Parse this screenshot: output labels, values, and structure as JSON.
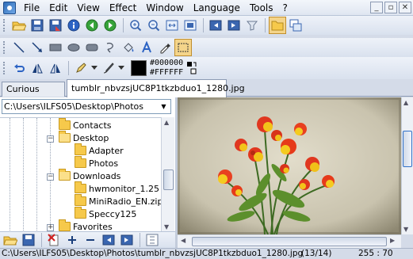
{
  "menu": {
    "items": [
      "File",
      "Edit",
      "View",
      "Effect",
      "Window",
      "Language",
      "Tools",
      "?"
    ]
  },
  "window_controls": {
    "minimize": "_",
    "restore": "▫",
    "close": "✕"
  },
  "colors": {
    "foreground_hex": "#000000",
    "background_hex": "#FFFFFF",
    "accent": "#3070c8"
  },
  "tabs": [
    {
      "label": "Curious Cat.jpg",
      "active": false
    },
    {
      "label": "tumblr_nbvzsjUC8P1tkzbduo1_1280.jpg",
      "active": true
    }
  ],
  "browser": {
    "path": "C:\\Users\\ILFS05\\Desktop\\Photos",
    "tree": [
      {
        "label": "Contacts",
        "type": "folder"
      },
      {
        "label": "Desktop",
        "type": "folder-open"
      },
      {
        "label": "Adapter",
        "type": "folder"
      },
      {
        "label": "Photos",
        "type": "folder"
      },
      {
        "label": "Downloads",
        "type": "folder-open"
      },
      {
        "label": "hwmonitor_1.25",
        "type": "folder"
      },
      {
        "label": "MiniRadio_EN.zip",
        "type": "zip"
      },
      {
        "label": "Speccy125",
        "type": "folder"
      },
      {
        "label": "Favorites",
        "type": "folder"
      }
    ]
  },
  "status": {
    "file_path": "C:\\Users\\ILFS05\\Desktop\\Photos\\tumblr_nbvzsjUC8P1tkzbduo1_1280.jpg",
    "index": "(13/14)",
    "coords": "255 : 70"
  }
}
